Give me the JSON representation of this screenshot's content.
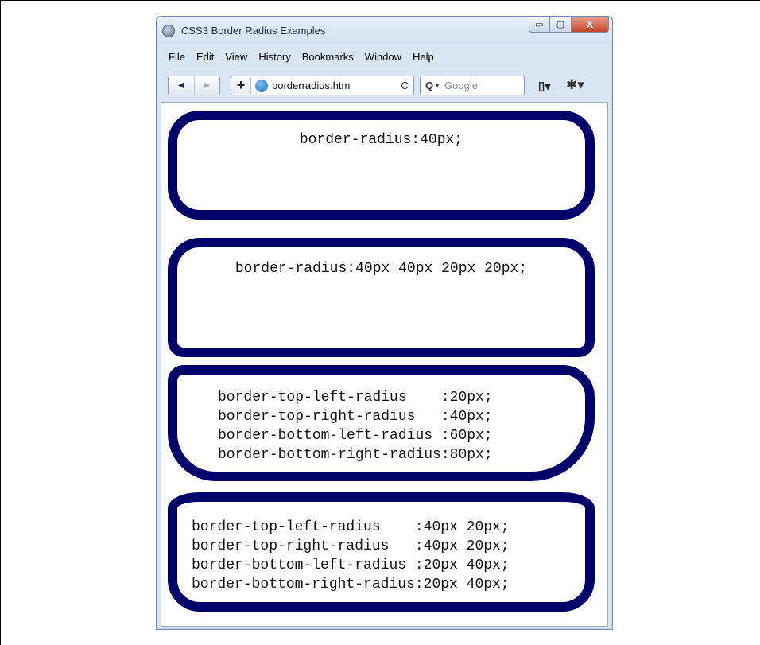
{
  "window": {
    "title": "CSS3 Border Radius Examples",
    "controls": {
      "minimize": "▭",
      "maximize": "▢",
      "close": "X"
    }
  },
  "menu": {
    "items": [
      {
        "label": "File"
      },
      {
        "label": "Edit"
      },
      {
        "label": "View"
      },
      {
        "label": "History"
      },
      {
        "label": "Bookmarks"
      },
      {
        "label": "Window"
      },
      {
        "label": "Help"
      }
    ]
  },
  "toolbar": {
    "back": "◀",
    "forward": "▶",
    "new_tab": "+",
    "address": "borderradius.htm",
    "reload": "C",
    "search_placeholder": "Google",
    "icons": {
      "back": "back-icon",
      "forward": "forward-icon",
      "globe": "globe-icon",
      "reload": "reload-icon",
      "search": "search-icon",
      "page": "page-menu-icon",
      "gear": "gear-icon"
    }
  },
  "boxes": [
    {
      "text": "border-radius:40px;"
    },
    {
      "text": "border-radius:40px 40px 20px 20px;"
    },
    {
      "text": "border-top-left-radius    :20px;\nborder-top-right-radius   :40px;\nborder-bottom-left-radius :60px;\nborder-bottom-right-radius:80px;"
    },
    {
      "text": "border-top-left-radius    :40px 20px;\nborder-top-right-radius   :40px 20px;\nborder-bottom-left-radius :20px 40px;\nborder-bottom-right-radius:20px 40px;"
    }
  ],
  "colors": {
    "border": "#00006b",
    "close_button": "#c4452e"
  }
}
